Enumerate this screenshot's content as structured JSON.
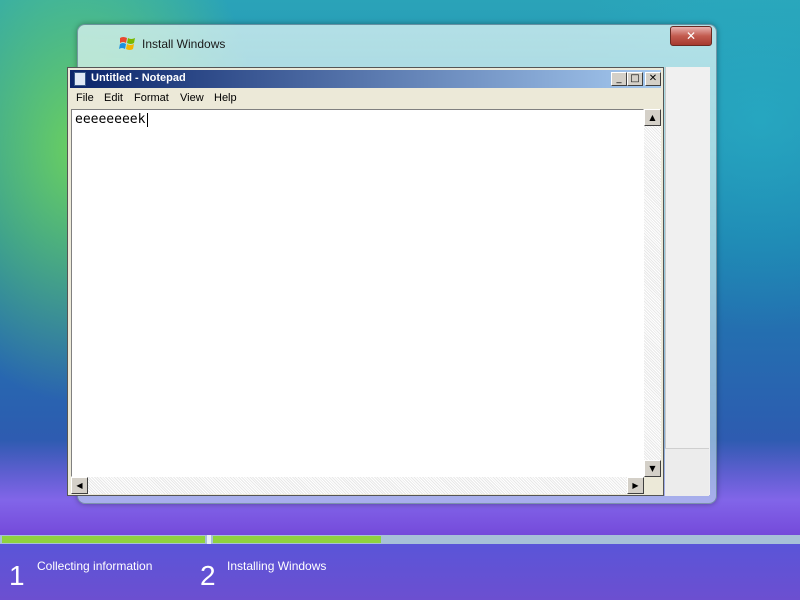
{
  "setup": {
    "title": "Install Windows",
    "close_glyph": "✕"
  },
  "notepad": {
    "title": "Untitled - Notepad",
    "menu": [
      "File",
      "Edit",
      "Format",
      "View",
      "Help"
    ],
    "content": "eeeeeeeek",
    "buttons": {
      "minimize": "_",
      "maximize": "□",
      "close": "✕"
    }
  },
  "progress": {
    "steps": [
      {
        "number": "1",
        "label": "Collecting information",
        "completed_fraction": 1.0
      },
      {
        "number": "2",
        "label": "Installing Windows",
        "completed_fraction": 0.29
      }
    ],
    "accent": "#8fd23f"
  },
  "icons": [
    "windows-logo-icon",
    "notepad-icon",
    "scroll-up-icon",
    "scroll-down-icon",
    "scroll-left-icon",
    "scroll-right-icon",
    "size-grip-icon"
  ]
}
